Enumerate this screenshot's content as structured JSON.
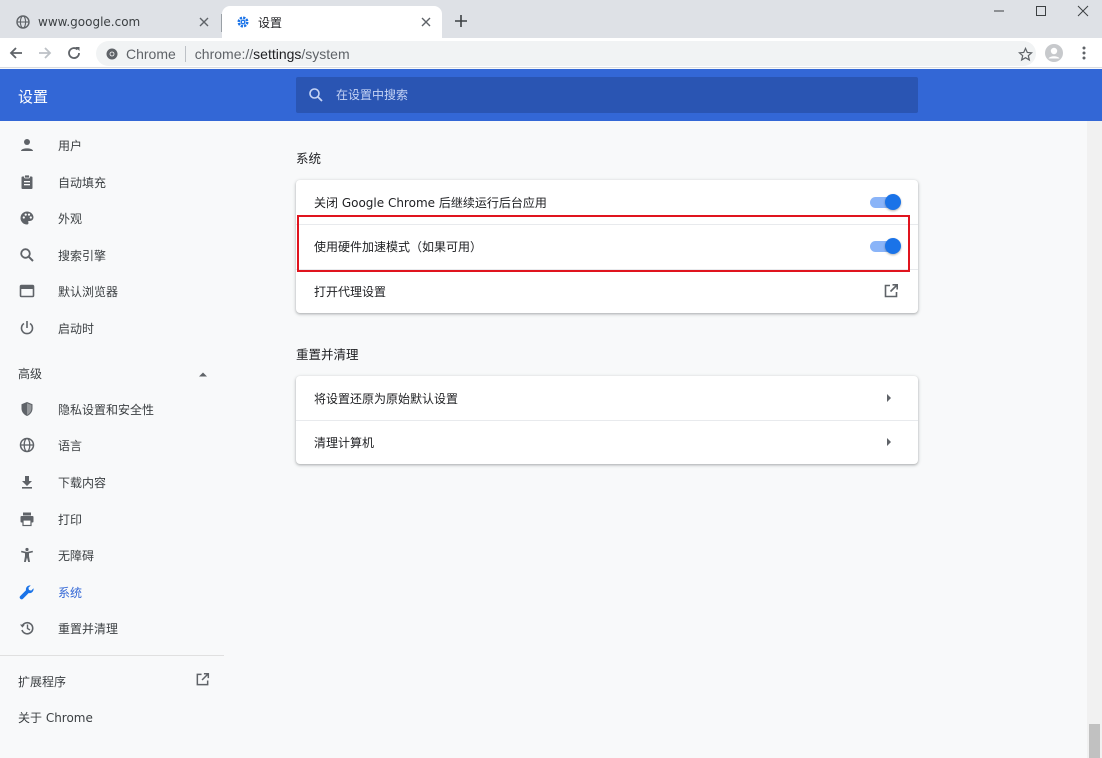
{
  "tabs": [
    {
      "title": "www.google.com",
      "icon": "globe-icon"
    },
    {
      "title": "设置",
      "icon": "gear-icon"
    }
  ],
  "toolbar": {
    "origin_label": "Chrome",
    "url_scheme": "chrome://",
    "url_host": "settings",
    "url_path": "/system"
  },
  "header": {
    "title": "设置",
    "search_placeholder": "在设置中搜索"
  },
  "sidebar": {
    "items": [
      {
        "label": "用户",
        "icon": "person-icon"
      },
      {
        "label": "自动填充",
        "icon": "clipboard-icon"
      },
      {
        "label": "外观",
        "icon": "palette-icon"
      },
      {
        "label": "搜索引擎",
        "icon": "search-icon"
      },
      {
        "label": "默认浏览器",
        "icon": "browser-icon"
      },
      {
        "label": "启动时",
        "icon": "power-icon"
      }
    ],
    "advanced_label": "高级",
    "advanced_items": [
      {
        "label": "隐私设置和安全性",
        "icon": "shield-icon"
      },
      {
        "label": "语言",
        "icon": "globe-icon"
      },
      {
        "label": "下载内容",
        "icon": "download-icon"
      },
      {
        "label": "打印",
        "icon": "printer-icon"
      },
      {
        "label": "无障碍",
        "icon": "accessibility-icon"
      },
      {
        "label": "系统",
        "icon": "wrench-icon",
        "selected": true
      },
      {
        "label": "重置并清理",
        "icon": "history-icon"
      }
    ],
    "extensions_label": "扩展程序",
    "about_label": "关于 Chrome"
  },
  "main": {
    "system": {
      "title": "系统",
      "rows": [
        {
          "label": "关闭 Google Chrome 后继续运行后台应用",
          "control": "toggle",
          "on": true
        },
        {
          "label": "使用硬件加速模式（如果可用）",
          "control": "toggle",
          "on": true
        },
        {
          "label": "打开代理设置",
          "control": "open-in-new-icon"
        }
      ]
    },
    "reset": {
      "title": "重置并清理",
      "rows": [
        {
          "label": "将设置还原为原始默认设置",
          "control": "arrow-right-icon"
        },
        {
          "label": "清理计算机",
          "control": "arrow-right-icon"
        }
      ]
    }
  },
  "colors": {
    "accent": "#3367d6",
    "search_bg": "#2a55b3",
    "toggle_knob": "#1a73e8",
    "highlight": "#e0141e"
  }
}
